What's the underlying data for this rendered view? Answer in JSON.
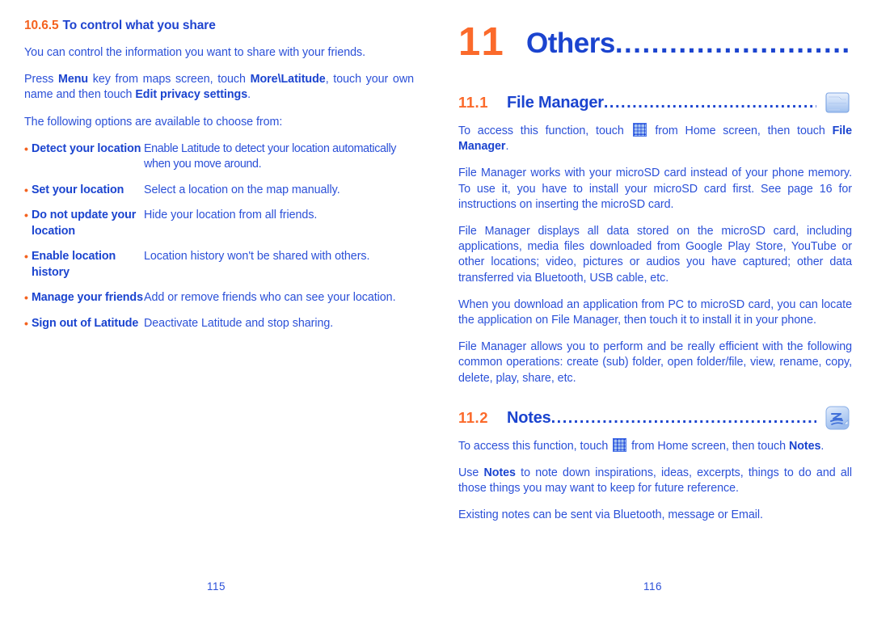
{
  "document": {
    "text_color": "#2b50d8",
    "heading_blue": "#1b44cf",
    "accent_orange": "#fb6a2b"
  },
  "left_page": {
    "page_number": "115",
    "heading": {
      "number": "10.6.5",
      "title": "To control what you share"
    },
    "paragraphs": [
      "You can control the information you want to share with your friends.",
      "The following options are available to choose from:"
    ],
    "press_menu": {
      "p1": "Press ",
      "b1": "Menu",
      "p2": " key from maps screen, touch ",
      "b2": "More\\Latitude",
      "p3": ", touch your own name and then touch ",
      "b3": "Edit privacy settings",
      "p4": "."
    },
    "options": [
      {
        "bullet": "•",
        "term": "Detect your location",
        "desc": "Enable Latitude to detect your location automatically when you move around."
      },
      {
        "bullet": "•",
        "term": "Set your location",
        "desc": "Select a location on the map manually."
      },
      {
        "bullet": "•",
        "term": "Do not update your location",
        "desc": "Hide your location from all friends."
      },
      {
        "bullet": "•",
        "term": "Enable location history",
        "desc": "Location history won't be shared with others."
      },
      {
        "bullet": "•",
        "term": "Manage your friends",
        "desc": "Add or remove friends who can see your location."
      },
      {
        "bullet": "•",
        "term": "Sign out of Latitude",
        "desc": "Deactivate Latitude and stop sharing."
      }
    ]
  },
  "right_page": {
    "page_number": "116",
    "chapter": {
      "number": "11",
      "title": "Others",
      "leader": "................................"
    },
    "sections": [
      {
        "number": "11.1",
        "title": "File Manager",
        "leader": "...............................................",
        "icon": "file-manager-icon"
      },
      {
        "number": "11.2",
        "title": "Notes",
        "leader": ".......................................................",
        "icon": "notes-icon"
      }
    ],
    "file_manager": {
      "access": {
        "p1": "To access this function, touch ",
        "icon": "app-grid-icon",
        "p2": " from Home screen, then touch ",
        "b1": "File Manager",
        "p3": "."
      },
      "paragraphs": [
        "File Manager works with your microSD card instead of your phone memory. To use it, you have to install your microSD card first. See page 16 for instructions on inserting the microSD card.",
        "File Manager displays all data stored on the microSD card, including applications, media files downloaded from Google Play Store, YouTube or other locations;  video, pictures or audios you have captured; other data transferred via Bluetooth, USB cable, etc.",
        "When you download an application from PC to microSD card, you can locate the application on File Manager, then touch it to install it in your phone.",
        "File Manager allows you to perform and be really efficient with the following common operations: create (sub) folder, open folder/file, view, rename, copy, delete, play, share, etc."
      ]
    },
    "notes": {
      "access": {
        "p1": "To access this function, touch ",
        "icon": "app-grid-icon",
        "p2": " from Home screen, then touch ",
        "b1": "Notes",
        "p3": "."
      },
      "use": {
        "p1": "Use ",
        "b1": "Notes",
        "p2": " to note down inspirations, ideas, excerpts, things to do and all those things you may want to keep for future reference."
      },
      "paragraphs": [
        "Existing notes can be sent via Bluetooth, message or Email."
      ]
    }
  }
}
